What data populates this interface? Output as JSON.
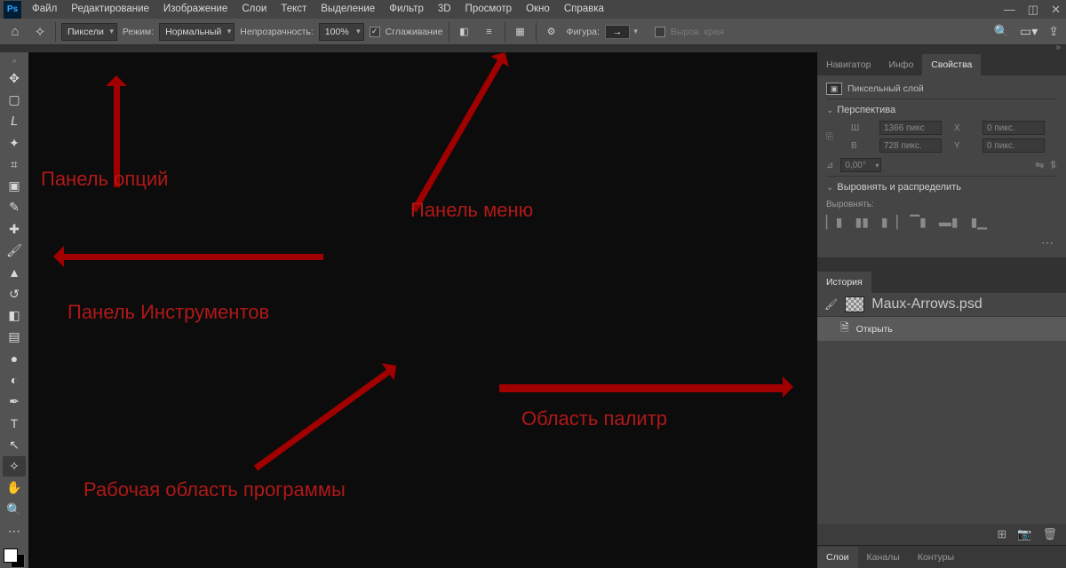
{
  "menubar": {
    "items": [
      "Файл",
      "Редактирование",
      "Изображение",
      "Слои",
      "Текст",
      "Выделение",
      "Фильтр",
      "3D",
      "Просмотр",
      "Окно",
      "Справка"
    ]
  },
  "optionsbar": {
    "unit_select": "Пиксели",
    "mode_label": "Режим:",
    "mode_value": "Нормальный",
    "opacity_label": "Непрозрачность:",
    "opacity_value": "100%",
    "antialias_label": "Сглаживание",
    "figure_label": "Фигура:",
    "figure_glyph": "→",
    "align_edges_label": "Выров. края"
  },
  "panels": {
    "top_tabs": [
      "Навигатор",
      "Инфо",
      "Свойства"
    ],
    "top_active": 2,
    "layer_type": "Пиксельный слой",
    "perspective_head": "Перспектива",
    "dims": {
      "w_lbl": "Ш",
      "w_val": "1366 пикс",
      "h_lbl": "В",
      "h_val": "728 пикс.",
      "x_lbl": "X",
      "x_val": "0 пикс.",
      "y_lbl": "Y",
      "y_val": "0 пикс."
    },
    "angle_symbol": "⊿",
    "angle_value": "0,00°",
    "align_head": "Выровнять и распределить",
    "align_label": "Выровнять:",
    "history_tab": "История",
    "history_file": "Maux-Arrows.psd",
    "history_step": "Открыть",
    "bottom_tabs": [
      "Слои",
      "Каналы",
      "Контуры"
    ],
    "bottom_active": 0
  },
  "annotations": {
    "options": "Панель опций",
    "menu": "Панель меню",
    "tools": "Панель Инструментов",
    "palettes": "Область палитр",
    "workspace": "Рабочая область программы"
  }
}
